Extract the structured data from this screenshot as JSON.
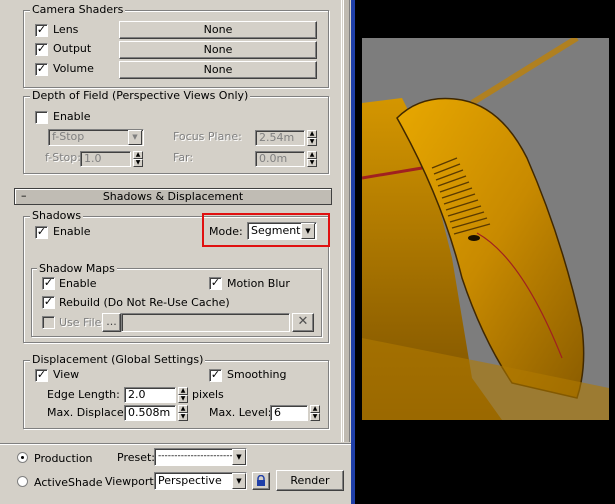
{
  "camera_shaders": {
    "title": "Camera Shaders",
    "rows": [
      {
        "label": "Lens",
        "checked": true,
        "button": "None"
      },
      {
        "label": "Output",
        "checked": true,
        "button": "None"
      },
      {
        "label": "Volume",
        "checked": true,
        "button": "None"
      }
    ]
  },
  "dof": {
    "title": "Depth of Field (Perspective Views Only)",
    "enable_label": "Enable",
    "mode_value": "f-Stop",
    "focus_plane_label": "Focus Plane:",
    "focus_plane_value": "2.54m",
    "fstop_label": "f-Stop:",
    "fstop_value": "1.0",
    "far_label": "Far:",
    "far_value": "0.0m"
  },
  "rollout": {
    "collapse_symbol": "–",
    "title": "Shadows & Displacement"
  },
  "shadows": {
    "title": "Shadows",
    "enable_label": "Enable",
    "enable_checked": true,
    "mode_label": "Mode:",
    "mode_value": "Segments",
    "highlight_color": "#e01010"
  },
  "shadow_maps": {
    "title": "Shadow Maps",
    "enable_label": "Enable",
    "motion_blur_label": "Motion Blur",
    "rebuild_label": "Rebuild (Do Not Re-Use Cache)",
    "use_file_label": "Use File",
    "browse_label": "...",
    "clear_symbol": "✕"
  },
  "displacement": {
    "title": "Displacement (Global Settings)",
    "view_label": "View",
    "smoothing_label": "Smoothing",
    "edge_length_label": "Edge Length:",
    "edge_length_value": "2.0",
    "edge_length_unit": "pixels",
    "max_displace_label": "Max. Displace:",
    "max_displace_value": "0.508m",
    "max_level_label": "Max. Level:",
    "max_level_value": "6"
  },
  "bottom": {
    "production_label": "Production",
    "activeshade_label": "ActiveShade",
    "preset_label": "Preset:",
    "preset_value": "-------------------------",
    "viewport_label": "Viewport:",
    "viewport_value": "Perspective",
    "render_label": "Render"
  }
}
